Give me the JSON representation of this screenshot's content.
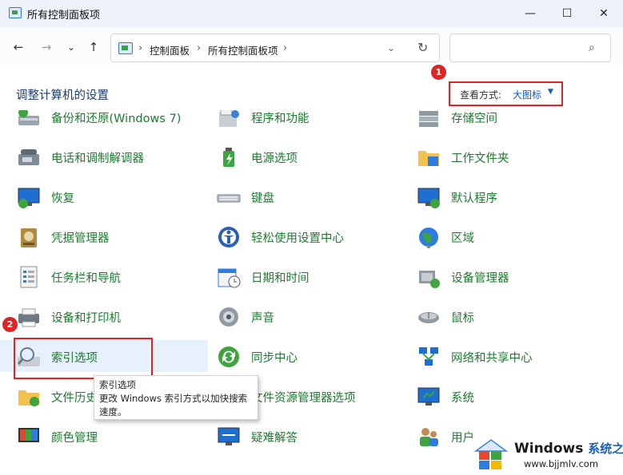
{
  "window": {
    "title": "所有控制面板项",
    "minimize": "—",
    "maximize": "☐",
    "close": "✕"
  },
  "nav": {
    "back": "←",
    "forward": "→",
    "recent": "⌄",
    "up": "↑"
  },
  "address": {
    "sep": "›",
    "crumbs": [
      "控制面板",
      "所有控制面板项"
    ],
    "dropdown": "⌄",
    "refresh": "↻"
  },
  "search": {
    "placeholder": "",
    "icon": "⌕"
  },
  "header": {
    "title": "调整计算机的设置",
    "view_label": "查看方式:",
    "view_value": "大图标",
    "view_caret": "▼"
  },
  "badges": {
    "one": "1",
    "two": "2"
  },
  "items": [
    {
      "label": "备份和还原(Windows 7)",
      "icon": "backup-icon"
    },
    {
      "label": "程序和功能",
      "icon": "programs-icon"
    },
    {
      "label": "存储空间",
      "icon": "storage-icon"
    },
    {
      "label": "电话和调制解调器",
      "icon": "phone-modem-icon"
    },
    {
      "label": "电源选项",
      "icon": "power-icon"
    },
    {
      "label": "工作文件夹",
      "icon": "work-folders-icon"
    },
    {
      "label": "恢复",
      "icon": "recovery-icon"
    },
    {
      "label": "键盘",
      "icon": "keyboard-icon"
    },
    {
      "label": "默认程序",
      "icon": "default-programs-icon"
    },
    {
      "label": "凭据管理器",
      "icon": "credential-icon"
    },
    {
      "label": "轻松使用设置中心",
      "icon": "ease-of-access-icon"
    },
    {
      "label": "区域",
      "icon": "region-icon"
    },
    {
      "label": "任务栏和导航",
      "icon": "taskbar-icon"
    },
    {
      "label": "日期和时间",
      "icon": "datetime-icon"
    },
    {
      "label": "设备管理器",
      "icon": "device-manager-icon"
    },
    {
      "label": "设备和打印机",
      "icon": "printer-icon"
    },
    {
      "label": "声音",
      "icon": "sound-icon"
    },
    {
      "label": "鼠标",
      "icon": "mouse-icon"
    },
    {
      "label": "索引选项",
      "icon": "indexing-icon"
    },
    {
      "label": "同步中心",
      "icon": "sync-icon"
    },
    {
      "label": "网络和共享中心",
      "icon": "network-icon"
    },
    {
      "label": "文件历史",
      "icon": "file-history-icon"
    },
    {
      "label": "文件资源管理器选项",
      "icon": "explorer-options-icon"
    },
    {
      "label": "系统",
      "icon": "system-icon"
    },
    {
      "label": "颜色管理",
      "icon": "color-icon"
    },
    {
      "label": "疑难解答",
      "icon": "troubleshoot-icon"
    },
    {
      "label": "用户",
      "icon": "user-accounts-icon"
    }
  ],
  "tooltip": {
    "title": "索引选项",
    "line1": "更改 Windows 索引方式以加快搜索",
    "line2": "速度。"
  },
  "watermark": {
    "brand": "Windows",
    "zh": "系统之家",
    "url": "www.bjjmlv.com"
  }
}
